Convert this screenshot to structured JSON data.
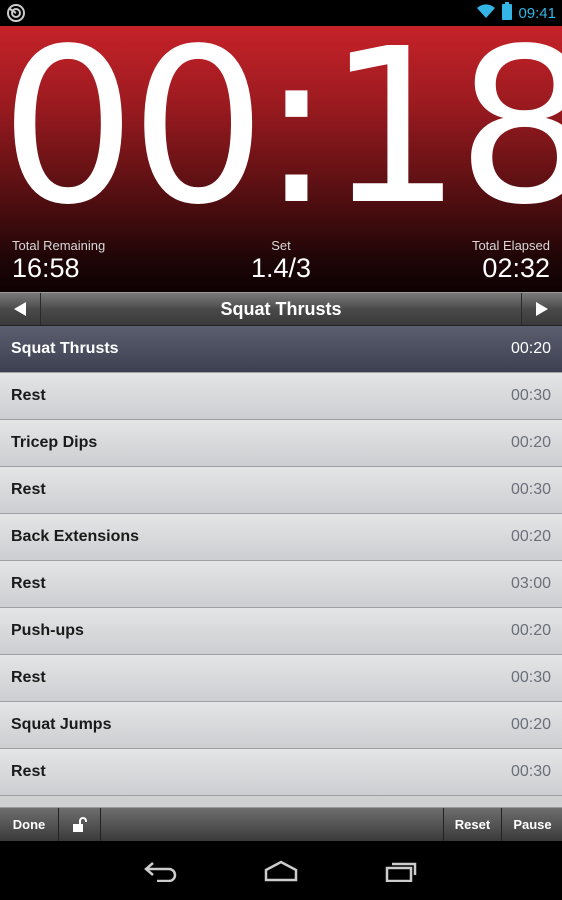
{
  "status_bar": {
    "time": "09:41",
    "icons": [
      "app-notification-icon",
      "wifi-icon",
      "battery-icon"
    ]
  },
  "timer": {
    "current": "00:18"
  },
  "stats": {
    "remaining_label": "Total Remaining",
    "remaining_value": "16:58",
    "set_label": "Set",
    "set_value": "1.4/3",
    "elapsed_label": "Total Elapsed",
    "elapsed_value": "02:32"
  },
  "nav": {
    "title": "Squat Thrusts",
    "prev_icon": "left-arrow-icon",
    "next_icon": "right-arrow-icon"
  },
  "intervals": [
    {
      "name": "Squat Thrusts",
      "duration": "00:20"
    },
    {
      "name": "Rest",
      "duration": "00:30"
    },
    {
      "name": "Tricep Dips",
      "duration": "00:20"
    },
    {
      "name": "Rest",
      "duration": "00:30"
    },
    {
      "name": "Back Extensions",
      "duration": "00:20"
    },
    {
      "name": "Rest",
      "duration": "03:00"
    },
    {
      "name": "Push-ups",
      "duration": "00:20"
    },
    {
      "name": "Rest",
      "duration": "00:30"
    },
    {
      "name": "Squat Jumps",
      "duration": "00:20"
    },
    {
      "name": "Rest",
      "duration": "00:30"
    }
  ],
  "toolbar": {
    "done_label": "Done",
    "reset_label": "Reset",
    "pause_label": "Pause",
    "lock_icon": "unlock-icon"
  },
  "colors": {
    "accent_blue": "#33b5e5",
    "timer_red": "#c62229",
    "active_row": "#4a4e5e"
  }
}
